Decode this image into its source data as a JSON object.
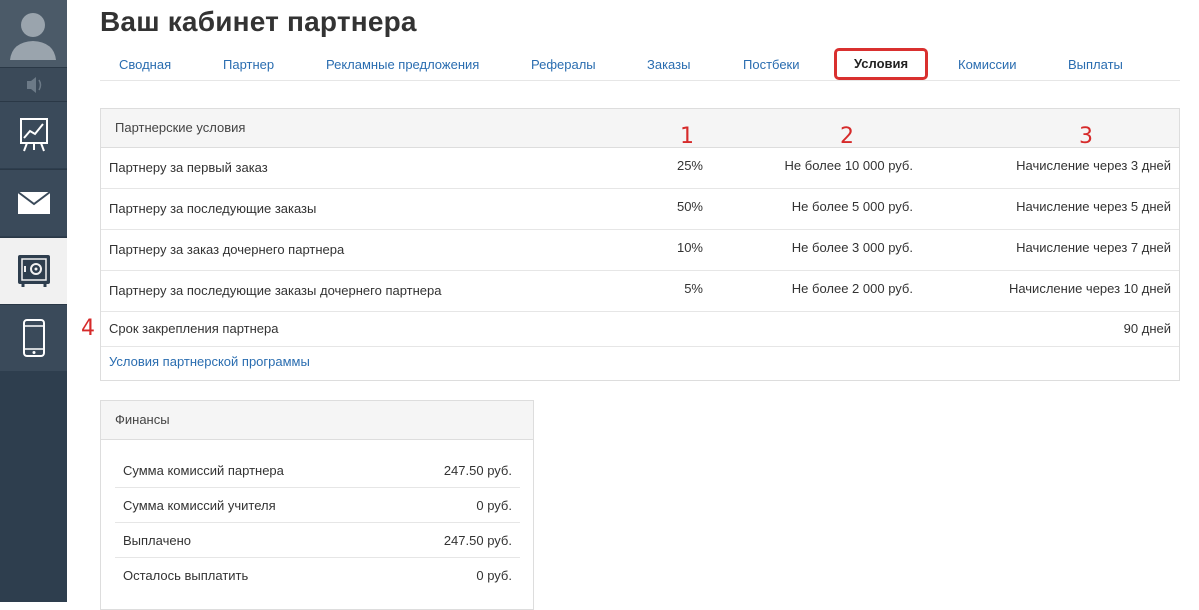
{
  "page": {
    "title": "Ваш кабинет партнера"
  },
  "tabs": [
    {
      "label": "Сводная"
    },
    {
      "label": "Партнер"
    },
    {
      "label": "Рекламные предложения"
    },
    {
      "label": "Рефералы"
    },
    {
      "label": "Заказы"
    },
    {
      "label": "Постбеки"
    },
    {
      "label": "Условия",
      "active": true
    },
    {
      "label": "Комиссии"
    },
    {
      "label": "Выплаты"
    }
  ],
  "sidebar": {
    "items": [
      {
        "icon": "user-avatar-icon"
      },
      {
        "icon": "speaker-icon"
      },
      {
        "icon": "chart-board-icon"
      },
      {
        "icon": "mail-icon"
      },
      {
        "icon": "safe-icon",
        "active": true
      },
      {
        "icon": "phone-icon"
      }
    ]
  },
  "conditions": {
    "heading": "Партнерские условия",
    "rows": [
      {
        "name": "Партнеру за первый заказ",
        "percent": "25%",
        "limit": "Не более 10 000 руб.",
        "accrual": "Начисление через 3 дней"
      },
      {
        "name": "Партнеру за последующие заказы",
        "percent": "50%",
        "limit": "Не более 5 000 руб.",
        "accrual": "Начисление через 5 дней"
      },
      {
        "name": "Партнеру за заказ дочернего партнера",
        "percent": "10%",
        "limit": "Не более 3 000 руб.",
        "accrual": "Начисление через 7 дней"
      },
      {
        "name": "Партнеру за последующие заказы дочернего партнера",
        "percent": "5%",
        "limit": "Не более 2 000 руб.",
        "accrual": "Начисление через 10 дней"
      },
      {
        "name": "Срок закрепления партнера",
        "percent": "",
        "limit": "",
        "accrual": "90 дней"
      }
    ],
    "link": "Условия партнерской программы"
  },
  "annotations": {
    "a1": "1",
    "a2": "2",
    "a3": "3",
    "a4": "4",
    "color": "#d62a2a"
  },
  "finance": {
    "heading": "Финансы",
    "rows": [
      {
        "label": "Сумма комиссий партнера",
        "value": "247.50 руб."
      },
      {
        "label": "Сумма комиссий учителя",
        "value": "0 руб."
      },
      {
        "label": "Выплачено",
        "value": "247.50 руб."
      },
      {
        "label": "Осталось выплатить",
        "value": "0 руб."
      }
    ]
  }
}
